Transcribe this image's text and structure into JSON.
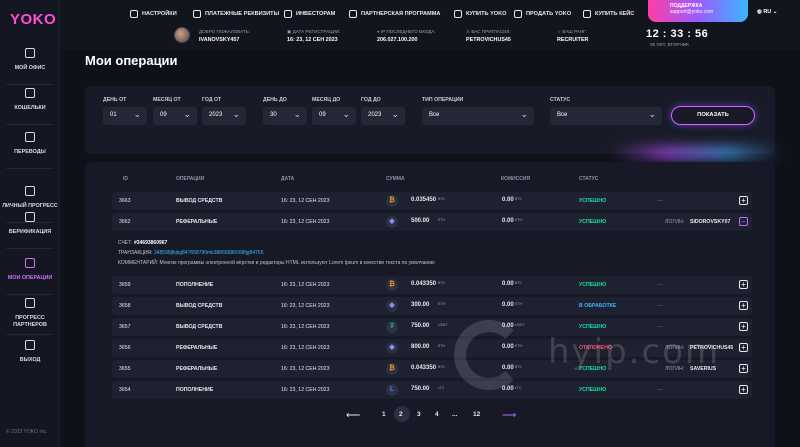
{
  "app": {
    "logo": "YOKO",
    "copyright": "© 2023 YOKO Inc."
  },
  "sidebar": {
    "items": [
      {
        "label": "МОЙ ОФИС",
        "icon": "grid-icon"
      },
      {
        "label": "КОШЕЛЬКИ",
        "icon": "wallet-icon"
      },
      {
        "label": "ПЕРЕВОДЫ",
        "icon": "transfer-icon"
      },
      {
        "label": "ЛИЧНЫЙ ПРОГРЕСС",
        "icon": "chart-icon"
      },
      {
        "label": "ВЕРИФИКАЦИЯ",
        "icon": "user-icon"
      },
      {
        "label": "МОИ ОПЕРАЦИИ",
        "icon": "calendar-icon",
        "active": true
      },
      {
        "label": "ПРОГРЕСС ПАРТНЕРОВ",
        "icon": "pie-icon"
      },
      {
        "label": "ВЫХОД",
        "icon": "logout-icon"
      }
    ]
  },
  "topnav": {
    "items": [
      "НАСТРОЙКИ",
      "ПЛАТЕЖНЫЕ РЕКВИЗИТЫ",
      "ИНВЕСТОРАМ",
      "ПАРТНЕРСКАЯ ПРОГРАММА",
      "КУПИТЬ YOKO",
      "ПРОДАТЬ YOKO",
      "КУПИТЬ КЕЙС"
    ],
    "support_title": "ПОДДЕРЖКА",
    "support_email": "support@yoko.com",
    "lang": "RU"
  },
  "userinfo": {
    "welcome_label": "ДОБРО ПОЖАЛОВАТЬ:",
    "welcome_value": "IVANOVSKY457",
    "reg_label": "ДАТА РЕГИСТРАЦИИ:",
    "reg_value": "16: 23, 12 СЕН 2023",
    "ip_label": "IP ПОСЛЕДНЕГО ВХОДА:",
    "ip_value": "206.027.100.200",
    "inviter_label": "ВАС ПРИГЛАСИЛ:",
    "inviter_value": "PETROVICHUS45",
    "rank_label": "ВАШ РАНГ:",
    "rank_value": "RECRUITER",
    "time": "12 : 33 : 56",
    "date": "05 ОКТ, ВТОРНИК"
  },
  "page": {
    "title": "Мои операции"
  },
  "filters": {
    "day_from_label": "ДЕНЬ ОТ",
    "day_from": "01",
    "month_from_label": "МЕСЯЦ ОТ",
    "month_from": "09",
    "year_from_label": "ГОД ОТ",
    "year_from": "2023",
    "day_to_label": "ДЕНЬ ДО",
    "day_to": "30",
    "month_to_label": "МЕСЯЦ ДО",
    "month_to": "09",
    "year_to_label": "ГОД ДО",
    "year_to": "2023",
    "type_label": "ТИП ОПЕРАЦИИ",
    "type": "Все",
    "status_label": "СТАТУС",
    "status": "Все",
    "show_button": "ПОКАЗАТЬ"
  },
  "table": {
    "headers": [
      "ID",
      "ОПЕРАЦИИ",
      "ДАТА",
      "СУММА",
      "КОМИССИЯ",
      "СТАТУС"
    ],
    "rows": [
      {
        "id": "3663",
        "op": "ВЫВОД СРЕДСТВ",
        "date": "16: 23, 12 СЕН 2023",
        "coin": "₿",
        "coin_color": "#f7931a",
        "amount": "0.035450",
        "unit": "BTC",
        "fee": "0.00",
        "fee_unit": "BTC",
        "status": "УСПЕШНО",
        "status_type": "ok",
        "login": "—",
        "login_label": "",
        "open": false
      },
      {
        "id": "3662",
        "op": "РЕФЕРАЛЬНЫЕ",
        "date": "16: 23, 12 СЕН 2023",
        "coin": "◆",
        "coin_color": "#8c8cff",
        "amount": "500.00",
        "unit": "ETH",
        "fee": "0.00",
        "fee_unit": "ETH",
        "status": "УСПЕШНО",
        "status_type": "ok",
        "login": "SIDOROVSKY07",
        "login_label": "ЛОГИН:",
        "open": true
      },
      {
        "id": "3659",
        "op": "ПОПОЛНЕНИЕ",
        "date": "16: 23, 12 СЕН 2023",
        "coin": "₿",
        "coin_color": "#f7931a",
        "amount": "0.043350",
        "unit": "BTC",
        "fee": "0.00",
        "fee_unit": "BTC",
        "status": "УСПЕШНО",
        "status_type": "ok",
        "login": "—",
        "login_label": "",
        "open": false
      },
      {
        "id": "3658",
        "op": "ВЫВОД СРЕДСТВ",
        "date": "16: 23, 12 СЕН 2023",
        "coin": "◆",
        "coin_color": "#8c8cff",
        "amount": "300.00",
        "unit": "ETH",
        "fee": "0.00",
        "fee_unit": "ETH",
        "status": "В ОБРАБОТКЕ",
        "status_type": "proc",
        "login": "—",
        "login_label": "",
        "open": false
      },
      {
        "id": "3657",
        "op": "ВЫВОД СРЕДСТВ",
        "date": "16: 23, 12 СЕН 2023",
        "coin": "₮",
        "coin_color": "#26a17b",
        "amount": "750.00",
        "unit": "USDT",
        "fee": "0.00",
        "fee_unit": "USDT",
        "status": "УСПЕШНО",
        "status_type": "ok",
        "login": "—",
        "login_label": "",
        "open": false
      },
      {
        "id": "3656",
        "op": "РЕФЕРАЛЬНЫЕ",
        "date": "16: 23, 12 СЕН 2023",
        "coin": "◆",
        "coin_color": "#8c8cff",
        "amount": "800.00",
        "unit": "ETH",
        "fee": "0.00",
        "fee_unit": "ETH",
        "status": "ОТКЛОНЕНО",
        "status_type": "rej",
        "login": "PETROVICHUS45",
        "login_label": "ЛОГИН:",
        "open": false
      },
      {
        "id": "3655",
        "op": "РЕФЕРАЛЬНЫЕ",
        "date": "16: 23, 12 СЕН 2023",
        "coin": "₿",
        "coin_color": "#f7931a",
        "amount": "0.043350",
        "unit": "BTC",
        "fee": "0.00",
        "fee_unit": "BTC",
        "status": "УСПЕШНО",
        "status_type": "ok",
        "login": "SAVERIUS",
        "login_label": "ЛОГИН:",
        "open": false
      },
      {
        "id": "3654",
        "op": "ПОПОЛНЕНИЕ",
        "date": "16: 23, 12 СЕН 2023",
        "coin": "Ł",
        "coin_color": "#3c6bff",
        "amount": "750.00",
        "unit": "LTC",
        "fee": "0.00",
        "fee_unit": "LTC",
        "status": "УСПЕШНО",
        "status_type": "ok",
        "login": "—",
        "login_label": "",
        "open": false
      }
    ],
    "detail": {
      "account_label": "СЧЕТ:",
      "account": "#34693860967",
      "tx_label": "ТРАНЗАКЦИЯ:",
      "tx": "348598jfkjkg847658790mk38865686008fjg84765",
      "comment_label": "КОММЕНТАРИЙ:",
      "comment": "Многие программы электронной вёрстки и редакторы HTML используют Lorem Ipsum в качестве текста по умолчанию"
    }
  },
  "pagination": {
    "pages": [
      "1",
      "2",
      "3",
      "4",
      "...",
      "12"
    ],
    "current": "2"
  },
  "watermark": "hyip.com"
}
